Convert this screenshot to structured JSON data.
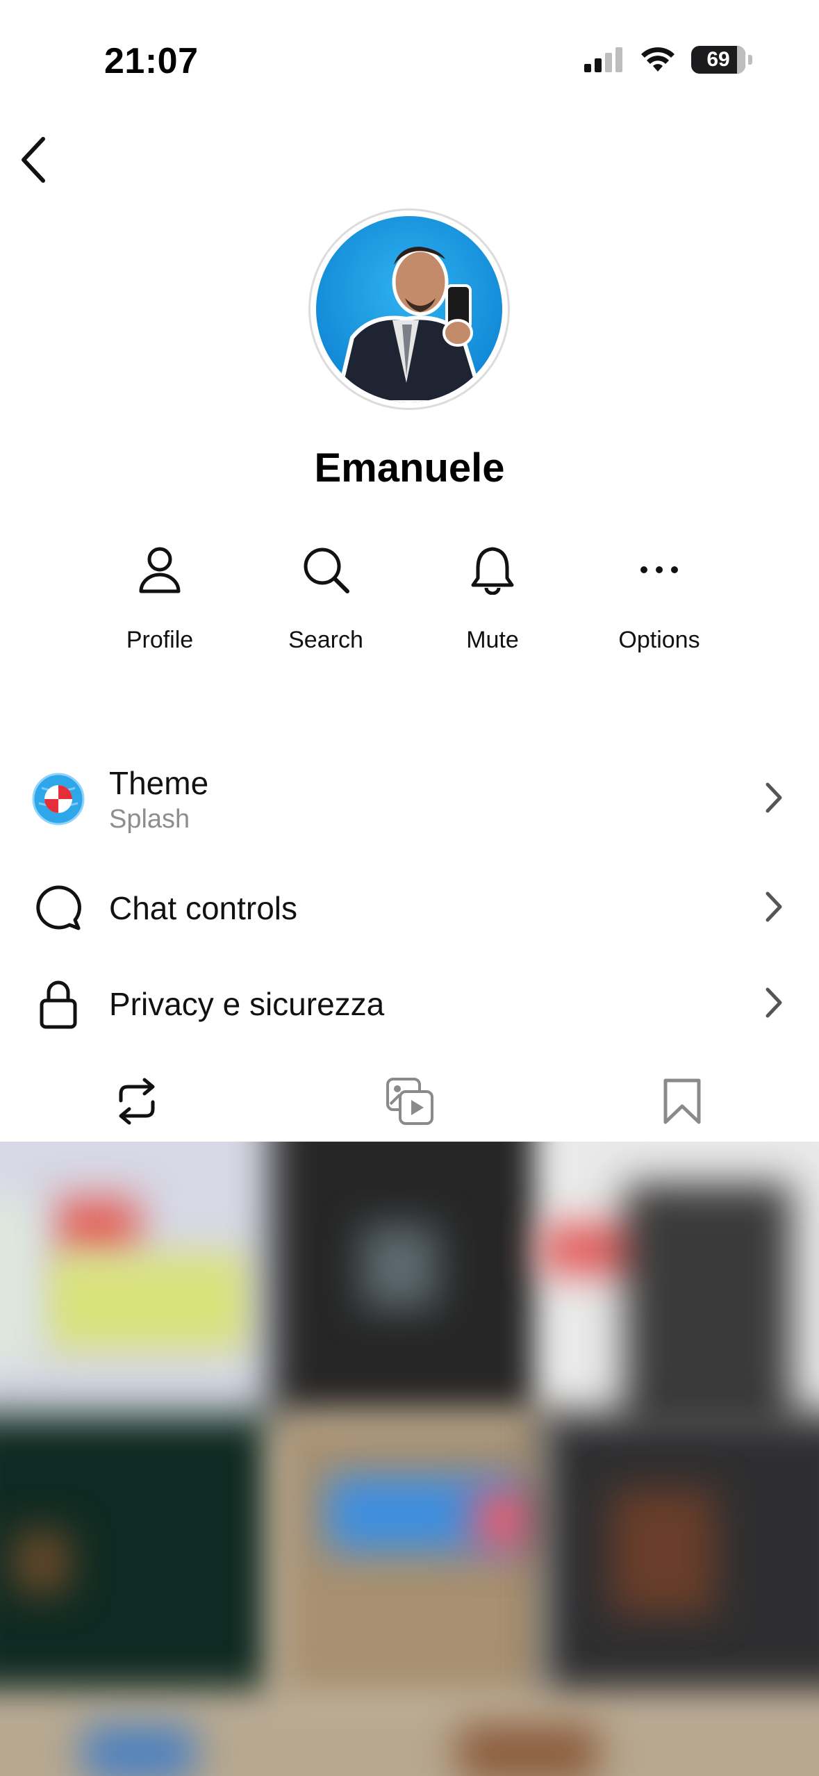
{
  "status_bar": {
    "time": "21:07",
    "battery": "69"
  },
  "profile": {
    "name": "Emanuele"
  },
  "actions": [
    {
      "label": "Profile",
      "icon": "person-icon"
    },
    {
      "label": "Search",
      "icon": "search-icon"
    },
    {
      "label": "Mute",
      "icon": "bell-icon"
    },
    {
      "label": "Options",
      "icon": "more-icon"
    }
  ],
  "settings": [
    {
      "title": "Theme",
      "subtitle": "Splash",
      "icon": "theme-ball-icon"
    },
    {
      "title": "Chat controls",
      "icon": "chat-bubble-icon"
    },
    {
      "title": "Privacy e sicurezza",
      "icon": "lock-icon"
    }
  ],
  "tabs": [
    {
      "name": "shared-posts-tab",
      "icon": "repost-icon"
    },
    {
      "name": "media-tab",
      "icon": "media-icon"
    },
    {
      "name": "saved-tab",
      "icon": "bookmark-icon"
    }
  ],
  "colors": {
    "accent_blue": "#1a9ae6",
    "subtitle_gray": "#8e8e8e"
  }
}
